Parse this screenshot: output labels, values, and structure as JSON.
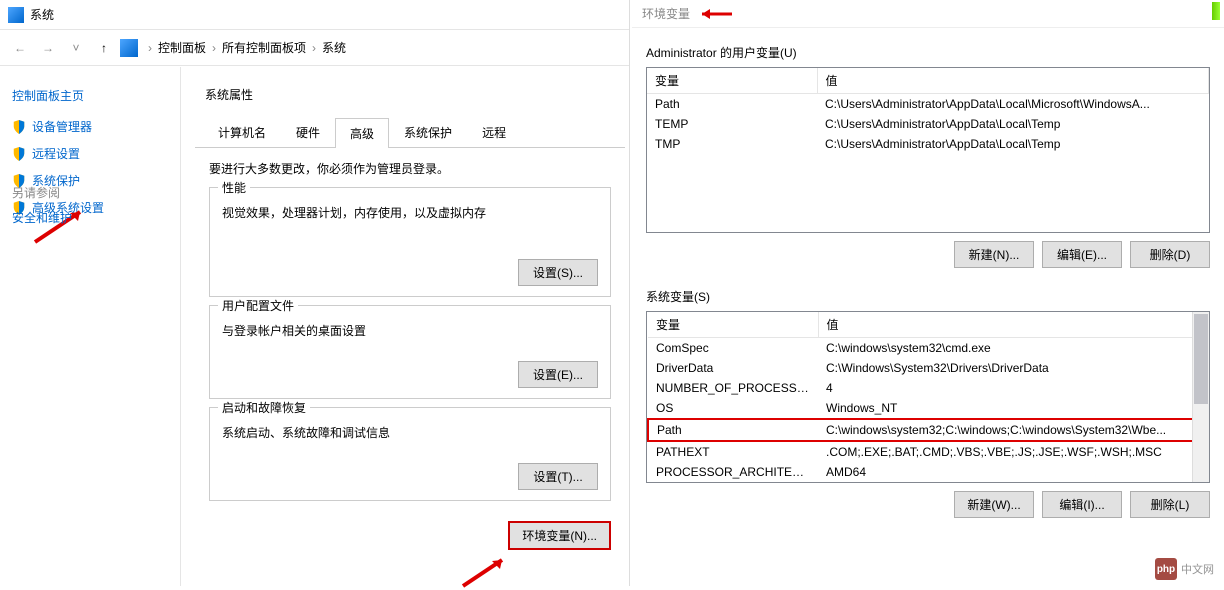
{
  "system_window": {
    "title": "系统",
    "breadcrumb": [
      "控制面板",
      "所有控制面板项",
      "系统"
    ]
  },
  "sidebar": {
    "title": "控制面板主页",
    "items": [
      {
        "label": "设备管理器"
      },
      {
        "label": "远程设置"
      },
      {
        "label": "系统保护"
      },
      {
        "label": "高级系统设置"
      }
    ],
    "see_also_title": "另请参阅",
    "see_also_link": "安全和维护"
  },
  "sysprops": {
    "title": "系统属性",
    "tabs": [
      "计算机名",
      "硬件",
      "高级",
      "系统保护",
      "远程"
    ],
    "active_tab": "高级",
    "intro": "要进行大多数更改，你必须作为管理员登录。",
    "groups": [
      {
        "title": "性能",
        "desc": "视觉效果，处理器计划，内存使用，以及虚拟内存",
        "btn": "设置(S)..."
      },
      {
        "title": "用户配置文件",
        "desc": "与登录帐户相关的桌面设置",
        "btn": "设置(E)..."
      },
      {
        "title": "启动和故障恢复",
        "desc": "系统启动、系统故障和调试信息",
        "btn": "设置(T)..."
      }
    ],
    "env_btn": "环境变量(N)..."
  },
  "env": {
    "title": "环境变量",
    "user_vars_label": "Administrator 的用户变量(U)",
    "headers": {
      "var": "变量",
      "val": "值"
    },
    "user_vars": [
      {
        "name": "Path",
        "value": "C:\\Users\\Administrator\\AppData\\Local\\Microsoft\\WindowsA..."
      },
      {
        "name": "TEMP",
        "value": "C:\\Users\\Administrator\\AppData\\Local\\Temp"
      },
      {
        "name": "TMP",
        "value": "C:\\Users\\Administrator\\AppData\\Local\\Temp"
      }
    ],
    "user_btns": {
      "new": "新建(N)...",
      "edit": "编辑(E)...",
      "delete": "删除(D)"
    },
    "sys_vars_label": "系统变量(S)",
    "sys_vars": [
      {
        "name": "ComSpec",
        "value": "C:\\windows\\system32\\cmd.exe"
      },
      {
        "name": "DriverData",
        "value": "C:\\Windows\\System32\\Drivers\\DriverData"
      },
      {
        "name": "NUMBER_OF_PROCESSORS",
        "value": "4"
      },
      {
        "name": "OS",
        "value": "Windows_NT"
      },
      {
        "name": "Path",
        "value": "C:\\windows\\system32;C:\\windows;C:\\windows\\System32\\Wbe...",
        "highlighted": true
      },
      {
        "name": "PATHEXT",
        "value": ".COM;.EXE;.BAT;.CMD;.VBS;.VBE;.JS;.JSE;.WSF;.WSH;.MSC"
      },
      {
        "name": "PROCESSOR_ARCHITECT...",
        "value": "AMD64"
      }
    ],
    "sys_btns": {
      "new": "新建(W)...",
      "edit": "编辑(I)...",
      "delete": "删除(L)"
    }
  },
  "watermark": {
    "logo": "php",
    "text": "中文网"
  }
}
